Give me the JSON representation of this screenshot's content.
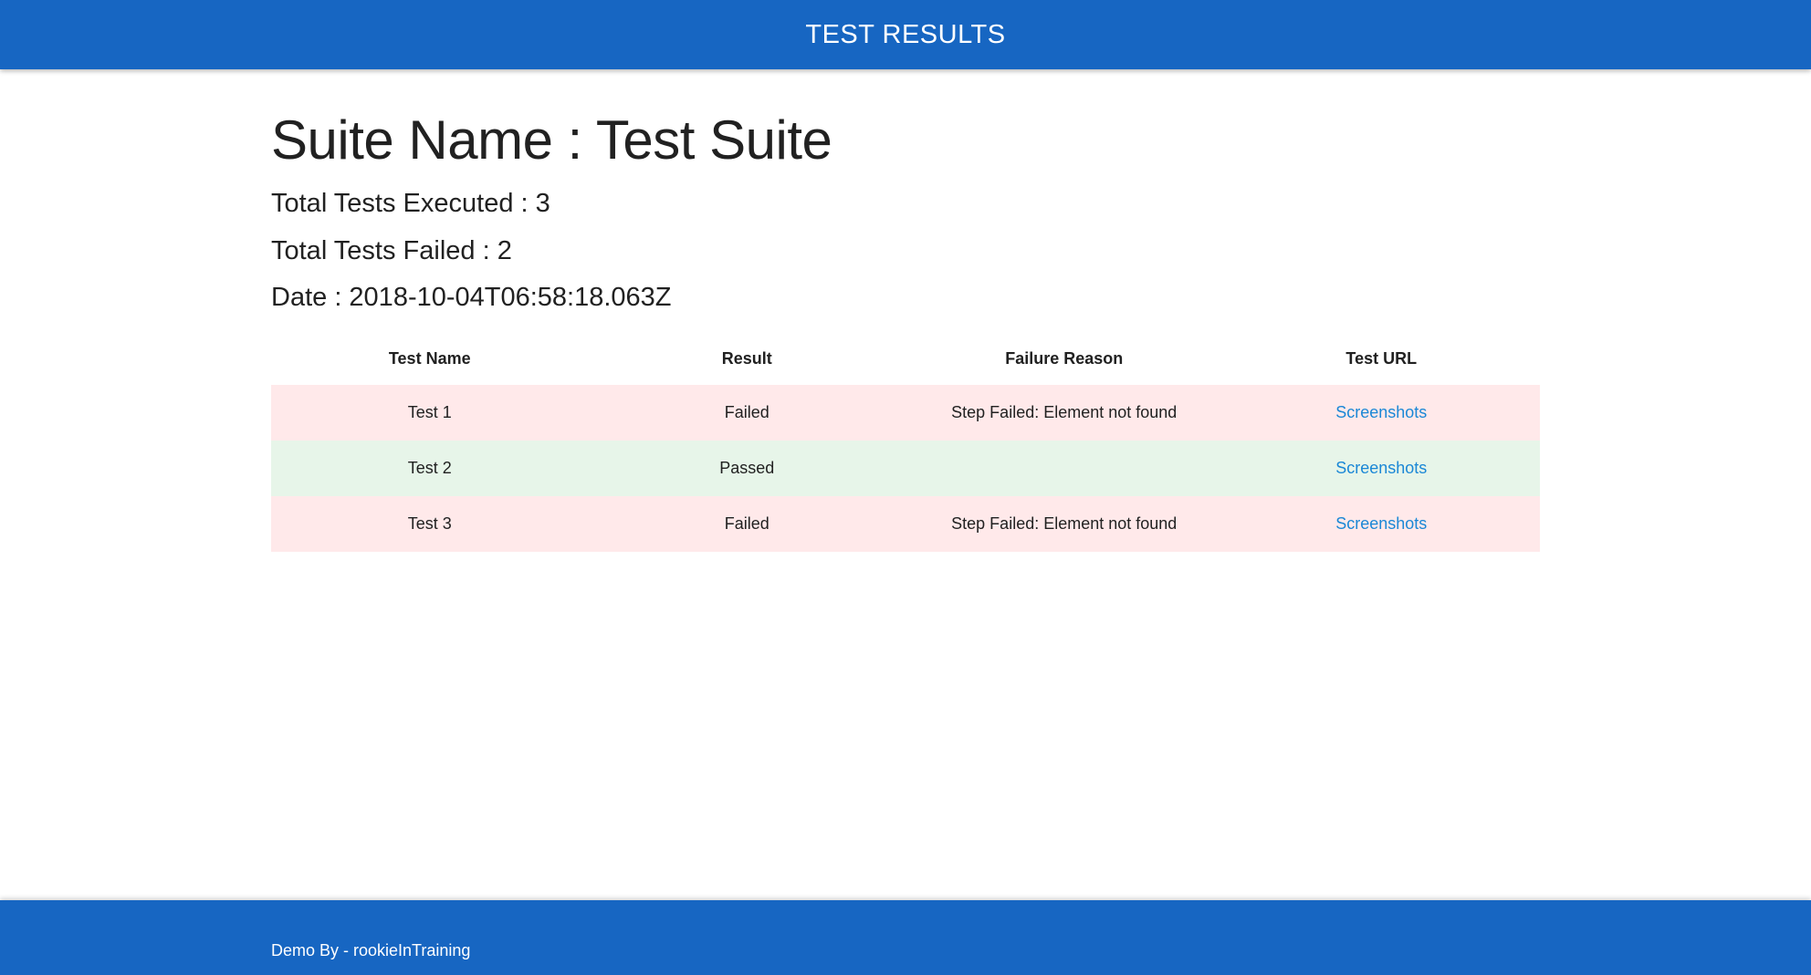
{
  "header": {
    "title": "TEST RESULTS"
  },
  "suite": {
    "title": "Suite Name : Test Suite",
    "total_executed": "Total Tests Executed : 3",
    "total_failed": "Total Tests Failed : 2",
    "date": "Date : 2018-10-04T06:58:18.063Z"
  },
  "table": {
    "headers": [
      "Test Name",
      "Result",
      "Failure Reason",
      "Test URL"
    ],
    "rows": [
      {
        "name": "Test 1",
        "result": "Failed",
        "reason": "Step Failed: Element not found",
        "url_label": "Screenshots"
      },
      {
        "name": "Test 2",
        "result": "Passed",
        "reason": "",
        "url_label": "Screenshots"
      },
      {
        "name": "Test 3",
        "result": "Failed",
        "reason": "Step Failed: Element not found",
        "url_label": "Screenshots"
      }
    ]
  },
  "colors": {
    "brand": "#1766c2",
    "failed_row": "#ffe9ea",
    "passed_row": "#e7f5e9",
    "link": "#1a87d6"
  },
  "footer": {
    "text": "Demo By - rookieInTraining"
  }
}
